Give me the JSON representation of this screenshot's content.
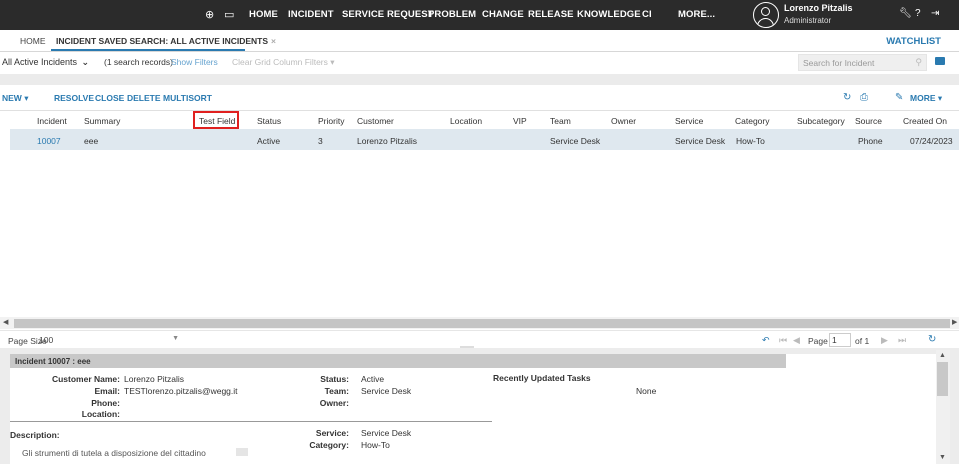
{
  "topnav": {
    "items": [
      "HOME",
      "INCIDENT",
      "SERVICE REQUEST",
      "PROBLEM",
      "CHANGE",
      "RELEASE",
      "KNOWLEDGE",
      "CI",
      "MORE..."
    ],
    "user": {
      "name": "Lorenzo Pitzalis",
      "role": "Administrator"
    },
    "icons": [
      "plus-circle-icon",
      "chat-icon",
      "user-avatar-icon",
      "wrench-icon",
      "help-icon",
      "logout-icon"
    ]
  },
  "tabs": {
    "home": "HOME",
    "active": "INCIDENT SAVED SEARCH: ALL ACTIVE INCIDENTS",
    "close": "×",
    "watchlist": "WATCHLIST"
  },
  "filter": {
    "saved_search": "All Active Incidents",
    "count": "(1 search records)",
    "show_filters": "Show Filters",
    "clear_filters": "Clear Grid Column Filters ▾",
    "search_placeholder": "Search for Incident"
  },
  "toolbar": {
    "new": "NEW ▾",
    "resolve": "RESOLVE",
    "close": "CLOSE",
    "delete": "DELETE",
    "multisort": "MULTISORT",
    "more": "MORE ▾"
  },
  "grid": {
    "columns": [
      "Incident",
      "Summary",
      "Test Field",
      "Status",
      "Priority",
      "Customer",
      "Location",
      "VIP",
      "Team",
      "Owner",
      "Service",
      "Category",
      "Subcategory",
      "Source",
      "Created On"
    ],
    "rows": [
      {
        "incident": "10007",
        "summary": "eee",
        "status": "Active",
        "priority": "3",
        "customer": "Lorenzo Pitzalis",
        "team": "Service Desk",
        "service": "Service Desk",
        "category": "How-To",
        "source": "Phone",
        "created": "07/24/2023"
      }
    ]
  },
  "pager": {
    "page_size_label": "Page Size",
    "page_size": "100",
    "page_label": "Page",
    "page": "1",
    "of": "of 1"
  },
  "detail": {
    "title": "Incident 10007 : eee",
    "customer_name_label": "Customer Name:",
    "customer_name": "Lorenzo Pitzalis",
    "email_label": "Email:",
    "email": "TESTlorenzo.pitzalis@wegg.it",
    "phone_label": "Phone:",
    "location_label": "Location:",
    "status_label": "Status:",
    "status": "Active",
    "team_label": "Team:",
    "team": "Service Desk",
    "owner_label": "Owner:",
    "tasks_label": "Recently Updated Tasks",
    "tasks_value": "None",
    "description_label": "Description:",
    "description": "Gli strumenti di tutela a disposizione del cittadino",
    "service_label": "Service:",
    "service": "Service Desk",
    "category_label": "Category:",
    "category": "How-To"
  }
}
